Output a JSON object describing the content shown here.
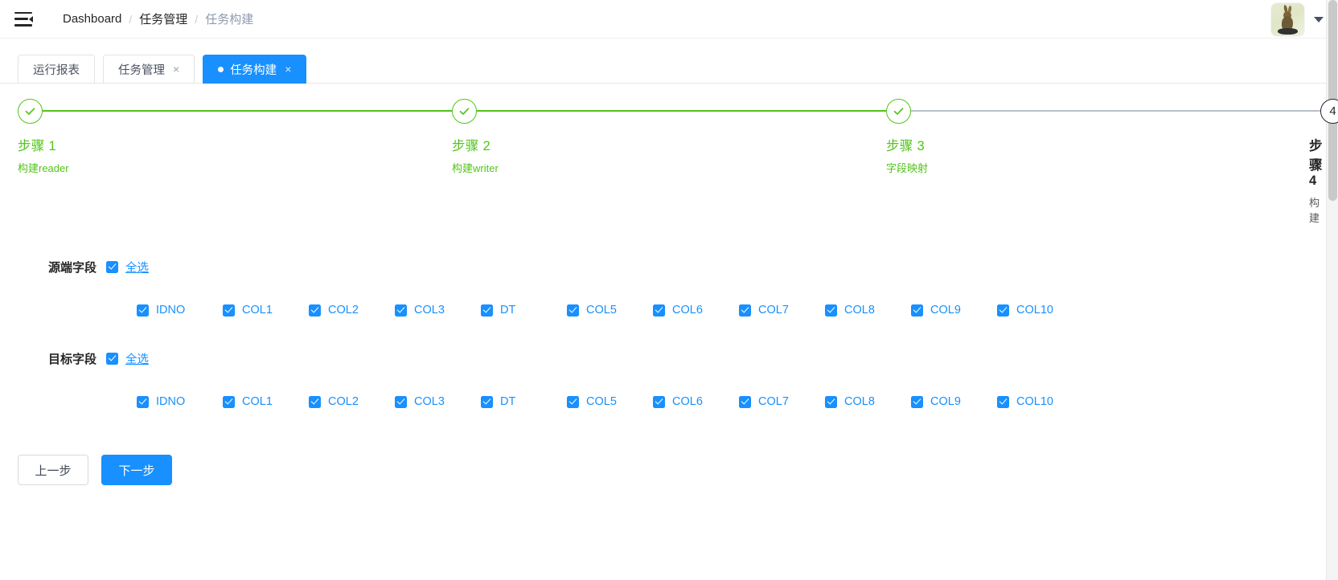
{
  "header": {
    "menu_icon": "hamburger-collapse-icon",
    "breadcrumb": [
      "Dashboard",
      "任务管理",
      "任务构建"
    ],
    "separator": "/",
    "avatar_icon": "user-avatar-hare",
    "caret_icon": "chevron-down-icon"
  },
  "tabs": [
    {
      "label": "运行报表",
      "closable": false,
      "active": false,
      "dot": false
    },
    {
      "label": "任务管理",
      "closable": true,
      "active": false,
      "dot": false,
      "close": "×"
    },
    {
      "label": "任务构建",
      "closable": true,
      "active": true,
      "dot": true,
      "close": "×"
    }
  ],
  "steps": [
    {
      "title": "步骤 1",
      "desc": "构建reader",
      "state": "done",
      "icon": "check-icon"
    },
    {
      "title": "步骤 2",
      "desc": "构建writer",
      "state": "done",
      "icon": "check-icon"
    },
    {
      "title": "步骤 3",
      "desc": "字段映射",
      "state": "done",
      "icon": "check-icon"
    },
    {
      "title": "步骤 4",
      "desc": "构建",
      "state": "active",
      "number": "4"
    }
  ],
  "form": {
    "source": {
      "label": "源端字段",
      "select_all": "全选",
      "columns": [
        "IDNO",
        "COL1",
        "COL2",
        "COL3",
        "DT",
        "COL5",
        "COL6",
        "COL7",
        "COL8",
        "COL9",
        "COL10"
      ]
    },
    "target": {
      "label": "目标字段",
      "select_all": "全选",
      "columns": [
        "IDNO",
        "COL1",
        "COL2",
        "COL3",
        "DT",
        "COL5",
        "COL6",
        "COL7",
        "COL8",
        "COL9",
        "COL10"
      ]
    }
  },
  "footer": {
    "prev_label": "上一步",
    "next_label": "下一步"
  },
  "colors": {
    "primary": "#1890ff",
    "success": "#52c41a",
    "pending": "#262626",
    "line_inactive": "#b9bfca"
  }
}
